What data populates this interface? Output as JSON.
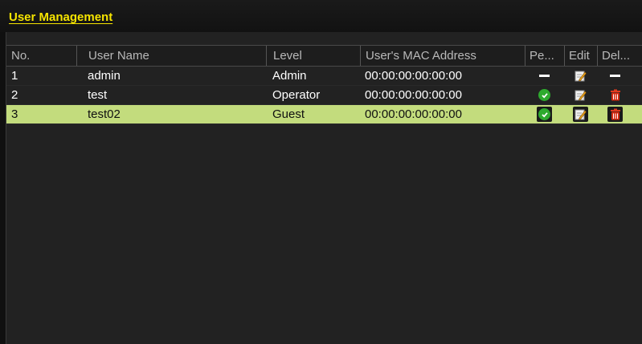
{
  "window": {
    "title": "User Management"
  },
  "table": {
    "columns": [
      "No.",
      "User Name",
      "Level",
      "User's MAC Address",
      "Pe...",
      "Edit",
      "Del..."
    ],
    "rows": [
      {
        "no": "1",
        "user_name": "admin",
        "level": "Admin",
        "mac": "00:00:00:00:00:00",
        "permission": "none",
        "edit": "edit-icon",
        "delete": "none",
        "selected": false
      },
      {
        "no": "2",
        "user_name": "test",
        "level": "Operator",
        "mac": "00:00:00:00:00:00",
        "permission": "check-icon",
        "edit": "edit-icon",
        "delete": "trash-icon",
        "selected": false
      },
      {
        "no": "3",
        "user_name": "test02",
        "level": "Guest",
        "mac": "00:00:00:00:00:00",
        "permission": "check-icon",
        "edit": "edit-icon",
        "delete": "trash-icon",
        "selected": true
      }
    ]
  },
  "colors": {
    "title": "#f6e400",
    "selected_row": "#c3dc7d",
    "check": "#2eaa2e",
    "delete": "#d42a10",
    "background": "#222222"
  }
}
